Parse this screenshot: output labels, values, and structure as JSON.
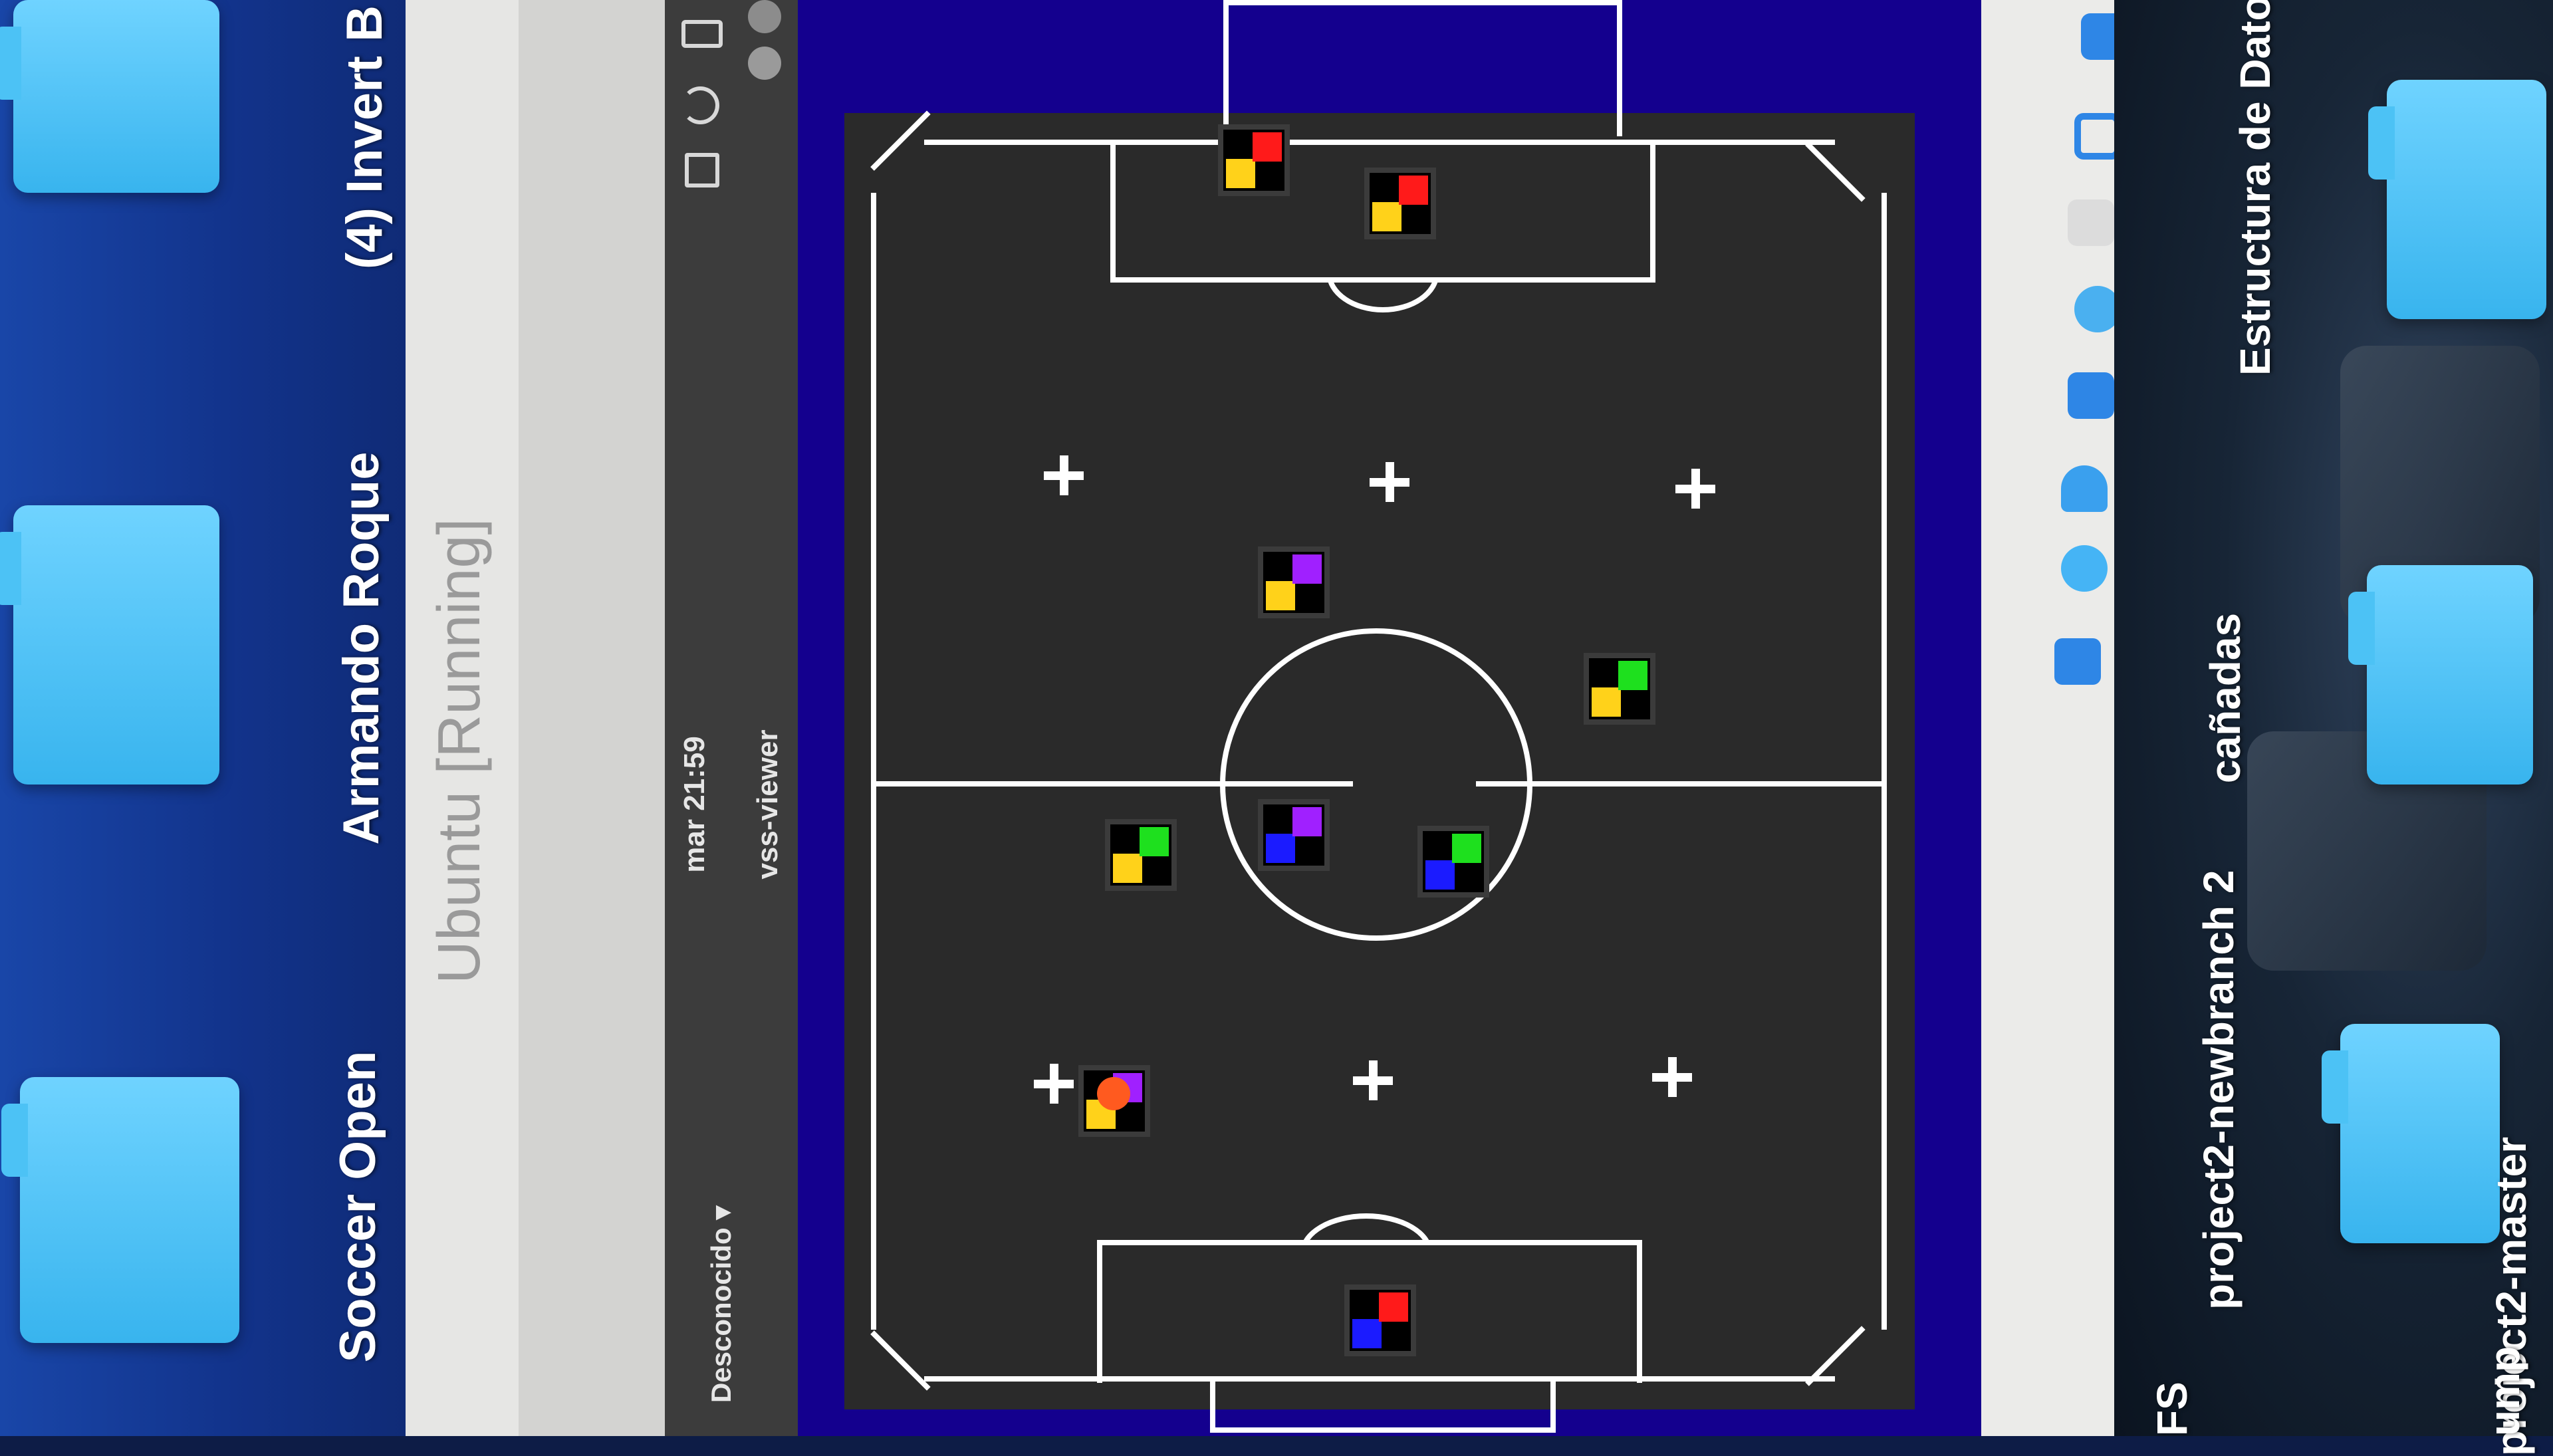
{
  "desktop_left": {
    "labels": [
      "Soccer Open",
      "Armando Roque",
      "(4) Invert B"
    ]
  },
  "window": {
    "title": "Ubuntu [Running]"
  },
  "topbar": {
    "network_label": "Desconocido",
    "network_arrow": "▾",
    "clock": "mar 21:59",
    "app_name": "vss-viewer"
  },
  "desktop_right": {
    "labels": [
      "Estructura de Datos",
      "cañadas",
      "project2-newbranch 2",
      "project2-master",
      "FS",
      "ump"
    ]
  },
  "colors": {
    "field": "#2a2a2a",
    "canvas": "#14008e",
    "yellow": "#ffd21a",
    "blue": "#1b1bff",
    "red": "#ff1a1a",
    "green": "#1ee01e",
    "purple": "#a020ff",
    "ball": "#ff5a1f"
  },
  "icons": [
    "network-icon",
    "volume-icon",
    "battery-icon",
    "minimize-icon",
    "close-icon",
    "usb-icon",
    "shared-folders-icon",
    "audio-icon",
    "optical-disk-icon",
    "refresh-icon",
    "display-icon",
    "screen-icon"
  ]
}
